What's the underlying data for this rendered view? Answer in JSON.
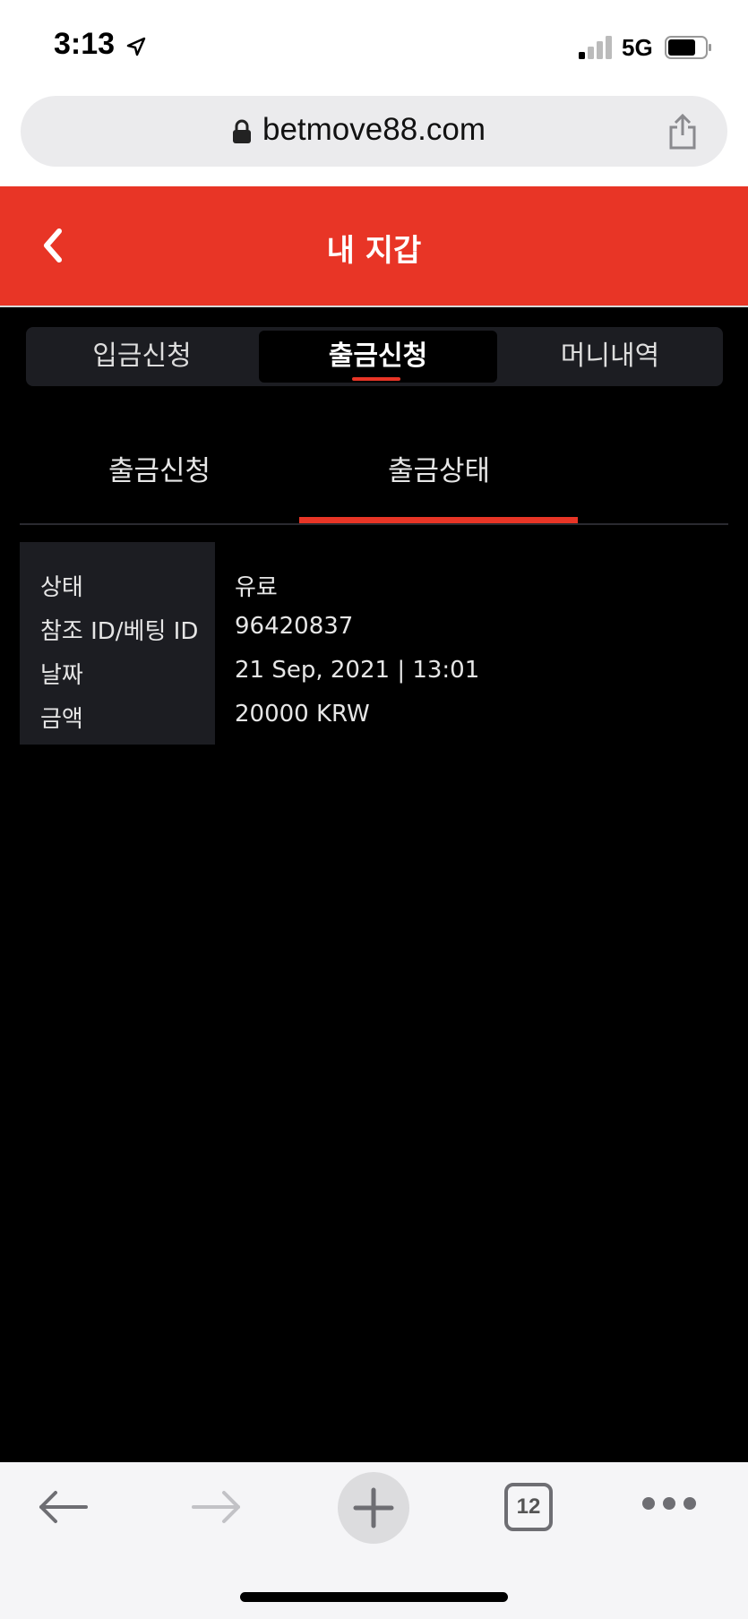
{
  "status_bar": {
    "time": "3:13",
    "network": "5G"
  },
  "browser": {
    "url": "betmove88.com",
    "tabs_count": "12"
  },
  "header": {
    "title": "내 지갑"
  },
  "main_tabs": [
    {
      "label": "입금신청"
    },
    {
      "label": "출금신청"
    },
    {
      "label": "머니내역"
    }
  ],
  "sub_tabs": [
    {
      "label": "출금신청"
    },
    {
      "label": "출금상태"
    }
  ],
  "withdrawal_info": {
    "rows": [
      {
        "label": "상태",
        "value": "유료"
      },
      {
        "label": "참조 ID/베팅 ID",
        "value": "96420837"
      },
      {
        "label": "날짜",
        "value": "21 Sep, 2021 | 13:01"
      },
      {
        "label": "금액",
        "value": "20000 KRW"
      }
    ]
  },
  "colors": {
    "accent": "#e83526",
    "background": "#000000",
    "panel": "#1c1d22"
  }
}
